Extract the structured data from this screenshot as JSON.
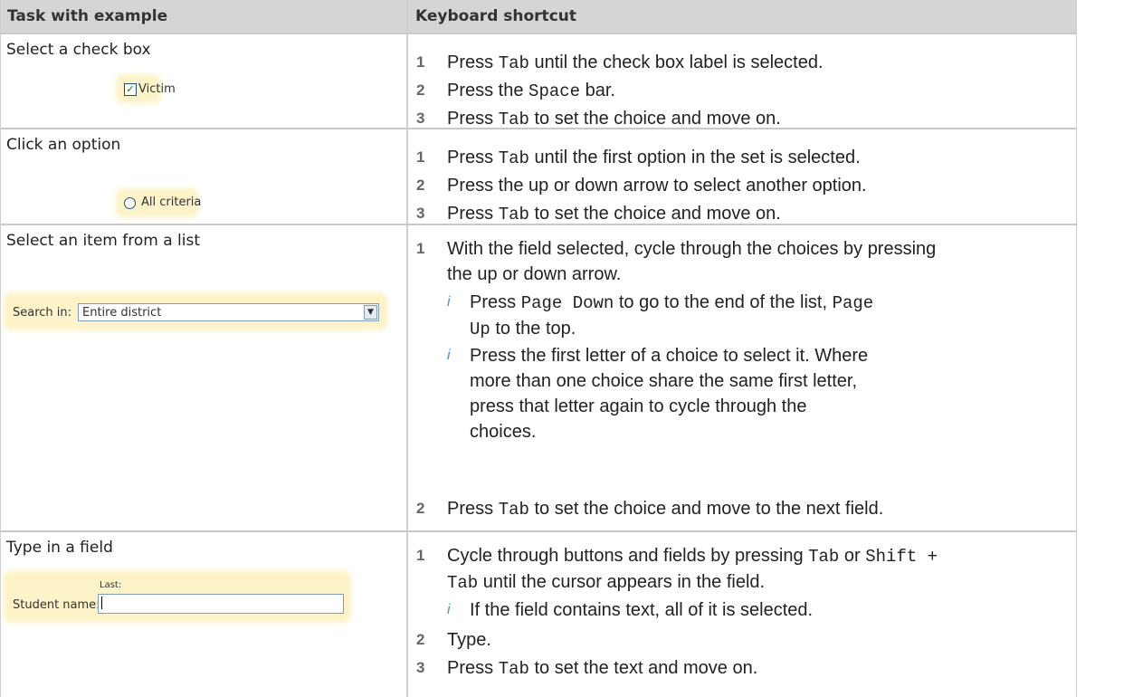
{
  "header": {
    "col1": "Task with example",
    "col2": "Keyboard shortcut"
  },
  "rows": [
    {
      "task": "Select a check box",
      "example": {
        "check_mark": "✓",
        "label": "Victim"
      },
      "steps": [
        {
          "num": "1",
          "pre": "Press ",
          "key": "Tab",
          "post": " until the check box label is selected."
        },
        {
          "num": "2",
          "pre": "Press the ",
          "key": "Space",
          "post": " bar."
        },
        {
          "num": "3",
          "pre": "Press ",
          "key": "Tab",
          "post": " to set the choice and move on."
        }
      ]
    },
    {
      "task": "Click an option",
      "example": {
        "label": "All criteria"
      },
      "steps": [
        {
          "num": "1",
          "pre": "Press ",
          "key": "Tab",
          "post": " until the first option in the set is selected."
        },
        {
          "num": "2",
          "text": "Press the up or down arrow to select another option."
        },
        {
          "num": "3",
          "pre": "Press ",
          "key": "Tab",
          "post": " to set the choice and move on."
        }
      ]
    },
    {
      "task": "Select an item from a list",
      "example": {
        "label": "Search in:",
        "value": "Entire district"
      },
      "steps": [
        {
          "num": "1",
          "line1": "With the field selected, cycle through the choices by pressing",
          "line2": "the up or down arrow."
        },
        {
          "num": "2",
          "pre": "Press ",
          "key": "Tab",
          "post": " to set the choice and move to the next field."
        }
      ],
      "tips": [
        {
          "icon": "i",
          "pre": "Press ",
          "key1": "Page Down",
          "mid": " to go to the end of the list, ",
          "key2a": "Page",
          "key2b": "Up",
          "post": " to the top."
        },
        {
          "icon": "i",
          "line1": "Press the first letter of a choice to select it. Where",
          "line2": "more than one choice share the same first letter,",
          "line3": "press that letter again to cycle through the",
          "line4": "choices."
        }
      ]
    },
    {
      "task": "Type in a field",
      "example": {
        "label": "Student name:",
        "sublabel": "Last:"
      },
      "steps": [
        {
          "num": "1",
          "pre": "Cycle through buttons and fields by pressing ",
          "key1": "Tab",
          "mid": " or ",
          "key2": "Shift +",
          "key3": "Tab",
          "post": " until the cursor appears in the field."
        },
        {
          "num": "2",
          "text": "Type."
        },
        {
          "num": "3",
          "pre": "Press ",
          "key": "Tab",
          "post": " to set the text and move on."
        }
      ],
      "tips": [
        {
          "icon": "i",
          "text": "If the field contains text, all of it is selected."
        }
      ]
    }
  ]
}
